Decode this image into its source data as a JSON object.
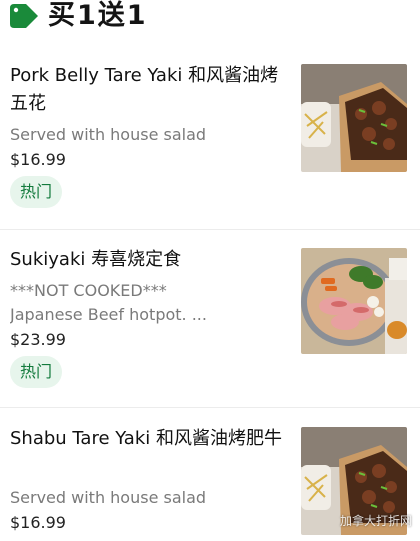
{
  "section": {
    "title": "买1送1",
    "icon": "tag-icon"
  },
  "items": [
    {
      "name": "Pork Belly Tare Yaki 和风酱油烤五花",
      "description": "Served with house salad",
      "price": "$16.99",
      "badge": "热门"
    },
    {
      "name": "Sukiyaki 寿喜烧定食",
      "description": "***NOT COOKED***",
      "description2": "Japanese Beef hotpot. ...",
      "price": "$23.99",
      "badge": "热门"
    },
    {
      "name": "Shabu Tare Yaki 和风酱油烤肥牛",
      "description": "Served with house salad",
      "price": "$16.99"
    }
  ],
  "watermark": "加拿大打折网",
  "colors": {
    "accent": "#1a8a3a",
    "badge_bg": "#e7f5ec",
    "badge_text": "#127a3c"
  }
}
